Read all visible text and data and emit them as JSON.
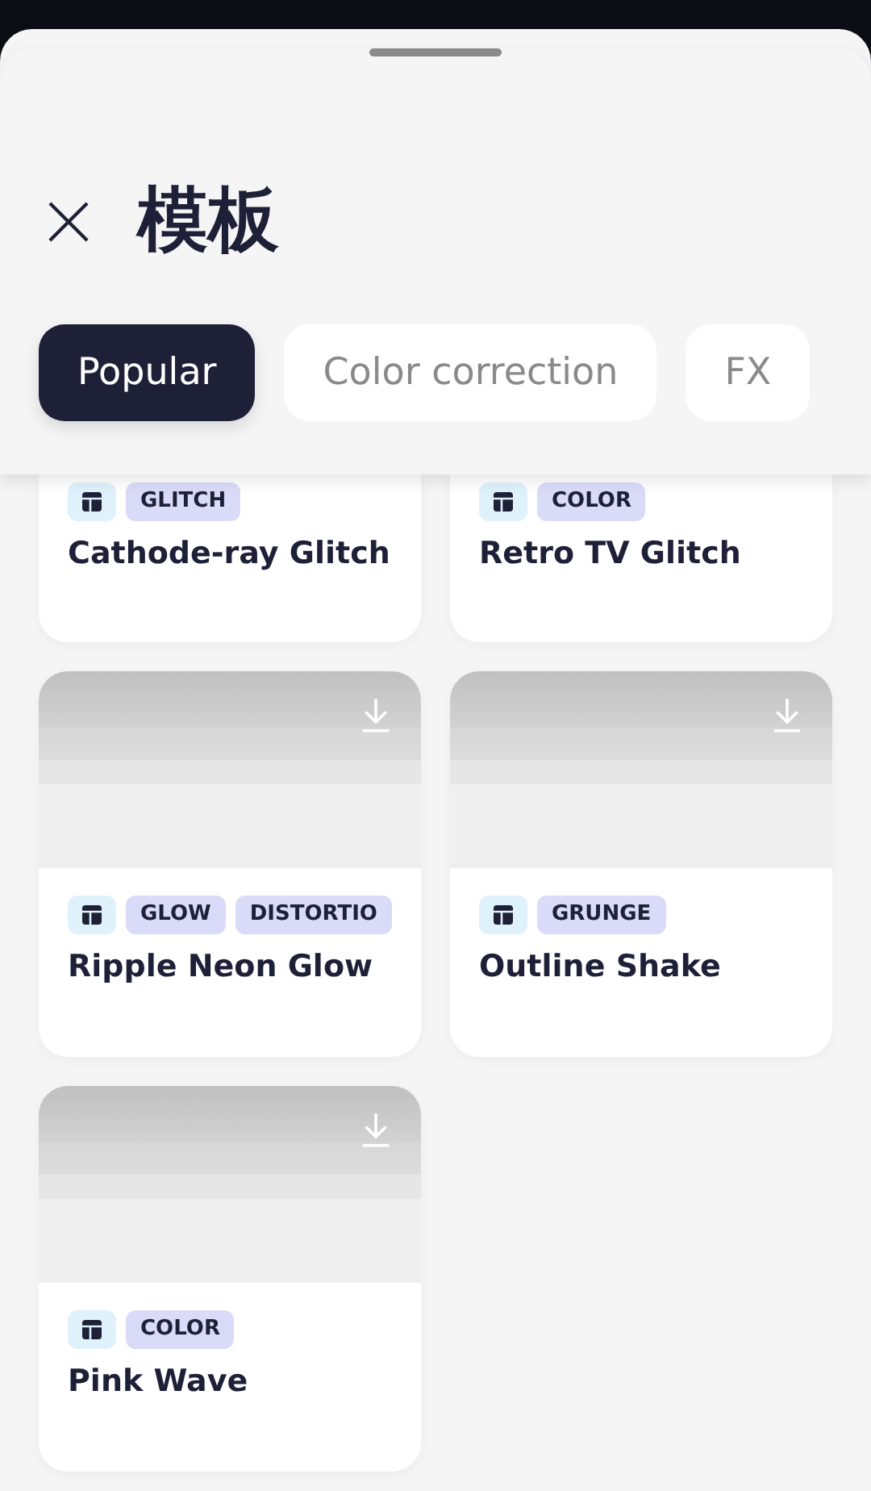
{
  "sheet": {
    "title": "模板"
  },
  "tabs": [
    {
      "label": "Popular",
      "selected": true
    },
    {
      "label": "Color correction",
      "selected": false
    },
    {
      "label": "FX",
      "selected": false
    }
  ],
  "templates": [
    {
      "kind": "cut",
      "name": "Cathode-ray Glitch",
      "tags": [
        "GLITCH"
      ]
    },
    {
      "kind": "cut",
      "name": "Retro TV Glitch",
      "tags": [
        "COLOR"
      ]
    },
    {
      "kind": "full",
      "name": "Ripple Neon Glow",
      "tags": [
        "GLOW",
        "DISTORTIO"
      ]
    },
    {
      "kind": "full",
      "name": "Outline Shake",
      "tags": [
        "GRUNGE"
      ]
    },
    {
      "kind": "full",
      "name": "Pink Wave",
      "tags": [
        "COLOR"
      ]
    }
  ]
}
